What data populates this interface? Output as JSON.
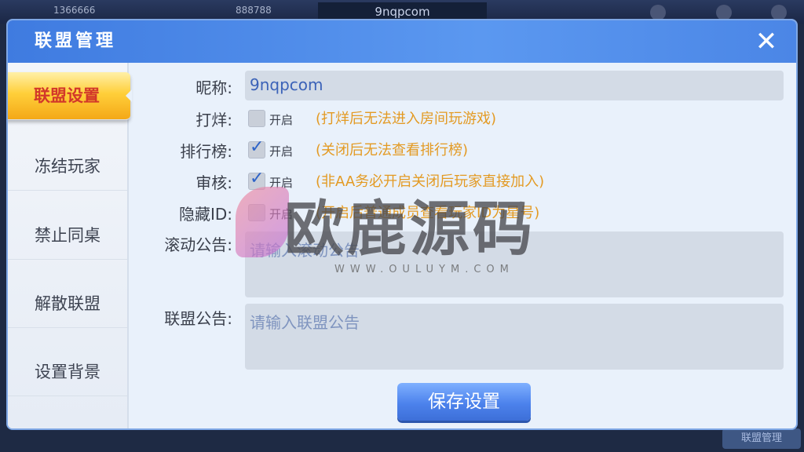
{
  "background": {
    "user_id": "1366666",
    "coins": "888788",
    "room_title": "9nqpcom",
    "bottom_button": "联盟管理"
  },
  "dialog": {
    "title": "联盟管理",
    "close_symbol": "✕"
  },
  "sidebar": {
    "items": [
      {
        "label": "联盟设置",
        "active": true
      },
      {
        "label": "冻结玩家"
      },
      {
        "label": "禁止同桌"
      },
      {
        "label": "解散联盟"
      },
      {
        "label": "设置背景"
      }
    ]
  },
  "form": {
    "nickname": {
      "label": "昵称:",
      "value": "9nqpcom"
    },
    "close_room": {
      "label": "打烊:",
      "checkbox_label": "开启",
      "checked": false,
      "hint": "(打烊后无法进入房间玩游戏)"
    },
    "leaderboard": {
      "label": "排行榜:",
      "checkbox_label": "开启",
      "checked": true,
      "hint": "(关闭后无法查看排行榜)"
    },
    "review": {
      "label": "审核:",
      "checkbox_label": "开启",
      "checked": true,
      "hint": "(非AA务必开启关闭后玩家直接加入)"
    },
    "hide_id": {
      "label": "隐藏ID:",
      "checkbox_label": "开启",
      "checked": false,
      "hint": "(开启后普通成员查看玩家ID为星号)"
    },
    "scroll_notice": {
      "label": "滚动公告:",
      "placeholder": "请输入滚动公告"
    },
    "alliance_notice": {
      "label": "联盟公告:",
      "placeholder": "请输入联盟公告"
    },
    "save_button": "保存设置"
  },
  "watermark": {
    "text": "欧鹿源码",
    "url": "WWW.OULUYM.COM"
  },
  "colors": {
    "title_bar": "#4b86e6",
    "active_tab": "#ffcf3a",
    "active_tab_text": "#d2372a",
    "hint_text": "#e39a23",
    "save_button": "#4c82ec"
  }
}
